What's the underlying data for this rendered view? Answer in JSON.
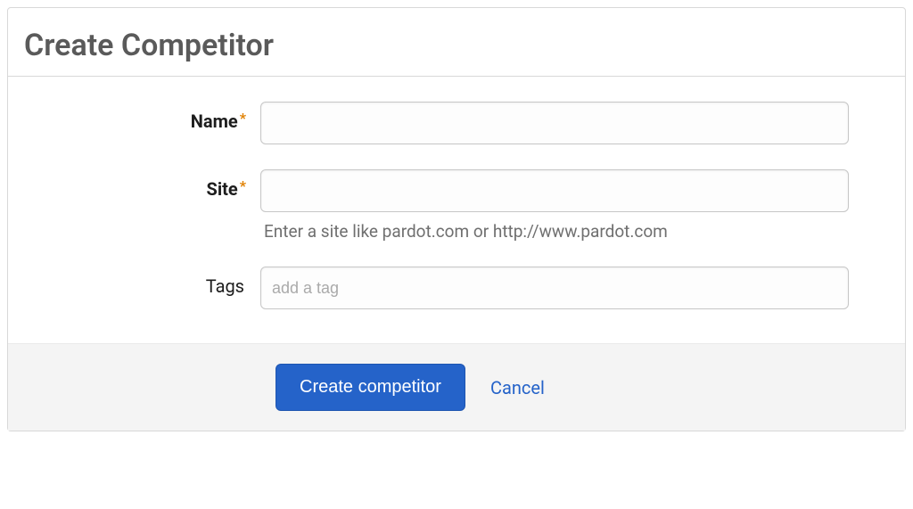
{
  "header": {
    "title": "Create Competitor"
  },
  "form": {
    "name": {
      "label": "Name",
      "value": "",
      "required": true
    },
    "site": {
      "label": "Site",
      "value": "",
      "required": true,
      "help": "Enter a site like pardot.com or http://www.pardot.com"
    },
    "tags": {
      "label": "Tags",
      "placeholder": "add a tag",
      "value": ""
    }
  },
  "actions": {
    "submit_label": "Create competitor",
    "cancel_label": "Cancel"
  },
  "required_marker": "*"
}
